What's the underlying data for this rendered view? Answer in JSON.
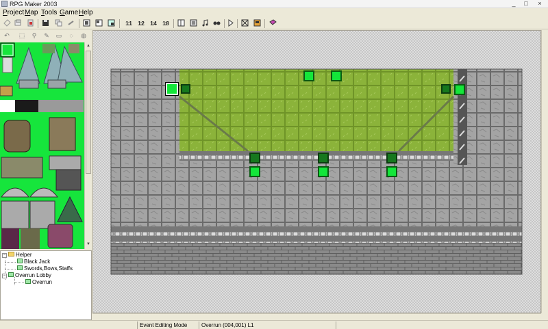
{
  "window": {
    "title": "RPG Maker 2003",
    "minimize": "_",
    "maximize": "□",
    "close": "×"
  },
  "menu": {
    "items": [
      {
        "label": "Project",
        "mnemonic": "P",
        "rest": "roject"
      },
      {
        "label": "Map",
        "mnemonic": "M",
        "rest": "ap"
      },
      {
        "label": "Tools",
        "mnemonic": "T",
        "rest": "ools"
      },
      {
        "label": "Game",
        "mnemonic": "G",
        "rest": "ame"
      },
      {
        "label": "Help",
        "mnemonic": "H",
        "rest": "elp"
      }
    ]
  },
  "toolbar": {
    "scale_1_1": "1:1",
    "scale_1_2": "1:2",
    "scale_1_4": "1:4",
    "scale_1_8": "1:8"
  },
  "tree": {
    "items": [
      {
        "label": "Helper",
        "type": "folder",
        "level": 0
      },
      {
        "label": "Black Jack",
        "type": "map",
        "level": 1
      },
      {
        "label": "Swords,Bows,Staffs",
        "type": "map",
        "level": 1
      },
      {
        "label": "Overrun Lobby",
        "type": "map",
        "level": 1
      },
      {
        "label": "Overrun",
        "type": "map",
        "level": 2
      }
    ]
  },
  "status": {
    "mode": "Event Editing Mode",
    "location": "Overrun (004,001) L1"
  },
  "colors": {
    "palette_green": "#16e53c",
    "grass": "#8bb33a",
    "stone_floor": "#9a9a9a",
    "event_light": "#14e63a",
    "event_dark": "#16781e"
  }
}
